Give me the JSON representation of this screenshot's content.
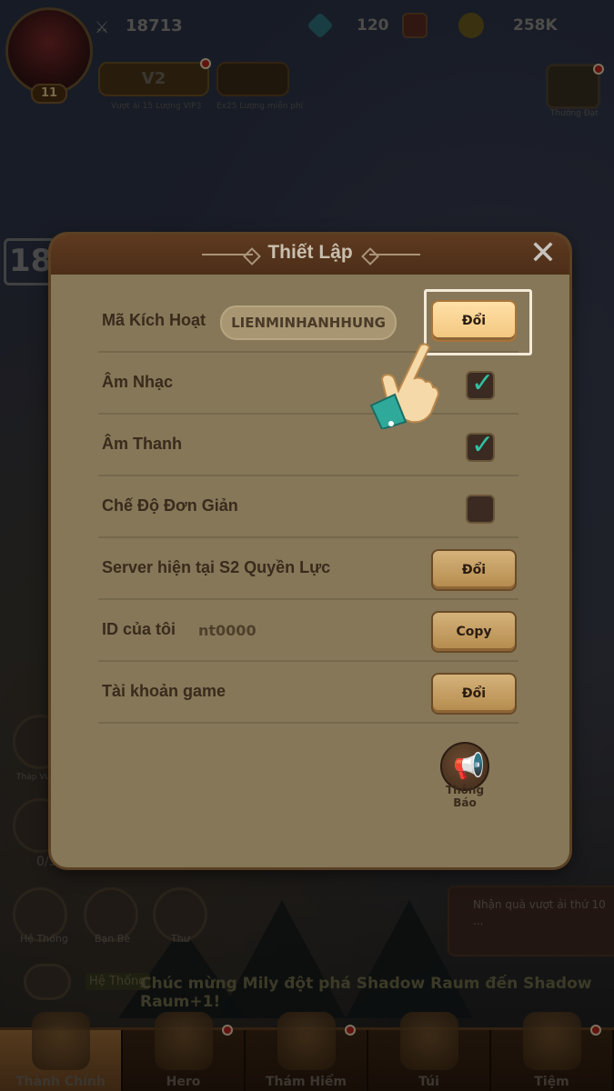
{
  "topbar": {
    "power": "18713",
    "gems": "120",
    "gold": "258K",
    "level": "11",
    "vip_label": "V2",
    "vip_caption": "Vượt ải 15 Lượng VIP3",
    "card_caption": "Ex25 Lượng miễn phí",
    "event_caption": "Thưởng Đạt"
  },
  "age_rating": "18+",
  "dialog": {
    "title": "Thiết Lập",
    "rows": [
      {
        "label": "Mã Kích Hoạt",
        "code": "LIENMINHANHHUNG",
        "button": "Đổi"
      },
      {
        "label": "Âm Nhạc",
        "checked": true
      },
      {
        "label": "Âm Thanh",
        "checked": true
      },
      {
        "label": "Chế Độ Đơn Giản",
        "checked": false
      },
      {
        "label": "Server hiện tại S2 Quyền Lực",
        "button": "Đổi"
      },
      {
        "label": "ID của tôi",
        "value": "nt0000",
        "button": "Copy"
      },
      {
        "label": "Tài khoản game",
        "button": "Đổi"
      }
    ],
    "announce_label": "Thông Báo"
  },
  "side": {
    "he_thong": "Hệ Thống",
    "ban_be": "Bạn Bè",
    "thu": "Thư",
    "thap": "Tháp Vương",
    "count": "0/3"
  },
  "quest": {
    "text": "Nhận quà vượt ải thứ 10 ..."
  },
  "ticker": {
    "tag": "Hệ Thống",
    "message": "Chúc mừng Mily đột phá Shadow Raum đến Shadow Raum+1!"
  },
  "nav": [
    {
      "label": "Thành Chính",
      "active": true
    },
    {
      "label": "Hero",
      "badge": true
    },
    {
      "label": "Thám Hiểm",
      "badge": true
    },
    {
      "label": "Túi"
    },
    {
      "label": "Tiệm",
      "badge": true
    }
  ],
  "colors": {
    "dialog_bg": "#857758",
    "header_bg": "#5e3a20",
    "check": "#2fc1a1",
    "button": "#d4b27a"
  }
}
